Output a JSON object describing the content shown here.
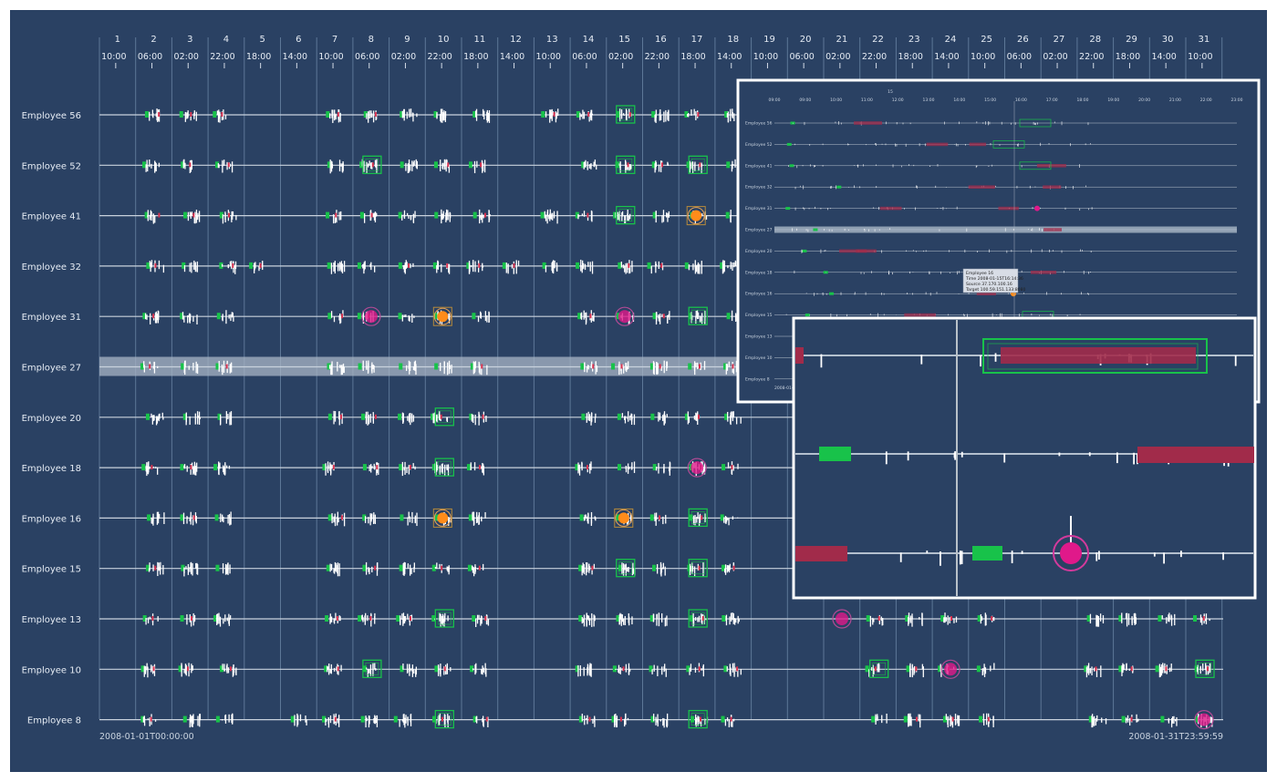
{
  "timeline": {
    "days": [
      "1",
      "2",
      "3",
      "4",
      "5",
      "6",
      "7",
      "8",
      "9",
      "10",
      "11",
      "12",
      "13",
      "14",
      "15",
      "16",
      "17",
      "18",
      "19",
      "20",
      "21",
      "22",
      "23",
      "24",
      "25",
      "26",
      "27",
      "28",
      "29",
      "30",
      "31"
    ],
    "times": [
      "10:00",
      "06:00",
      "02:00",
      "22:00",
      "18:00",
      "14:00",
      "10:00",
      "06:00",
      "02:00",
      "22:00",
      "18:00",
      "14:00",
      "10:00",
      "06:00",
      "02:00",
      "22:00",
      "18:00",
      "14:00",
      "10:00",
      "06:00",
      "02:00",
      "22:00",
      "18:00",
      "14:00",
      "10:00",
      "06:00",
      "02:00",
      "22:00",
      "18:00",
      "14:00",
      "10:00"
    ],
    "employees": [
      "Employee 56",
      "Employee 52",
      "Employee 41",
      "Employee 32",
      "Employee 31",
      "Employee 27",
      "Employee 20",
      "Employee 18",
      "Employee 16",
      "Employee 15",
      "Employee 13",
      "Employee 10",
      "Employee 8"
    ],
    "highlighted_employee": "Employee 27",
    "start_label": "2008-01-01T00:00:00",
    "end_label": "2008-01-31T23:59:59"
  },
  "detail_view": {
    "day_label": "15",
    "hours": [
      "09:00",
      "09:00",
      "10:00",
      "11:00",
      "12:00",
      "13:00",
      "14:00",
      "15:00",
      "16:00",
      "17:00",
      "18:00",
      "19:00",
      "20:00",
      "21:00",
      "22:00",
      "23:00"
    ],
    "employees": [
      "Employee 56",
      "Employee 52",
      "Employee 41",
      "Employee 32",
      "Employee 31",
      "Employee 27",
      "Employee 20",
      "Employee 18",
      "Employee 16",
      "Employee 15",
      "Employee 13",
      "Employee 10",
      "Employee 8"
    ],
    "start_label": "2008-01-",
    "tooltip": {
      "line1": "Employee 16",
      "line2": "Time 2008-01-15T16:14:36",
      "line3": "Source 37.170.100.16",
      "line4": "Target 100.59.151.133:8080"
    }
  },
  "colors": {
    "background": "#2a4163",
    "highlight_row": "#a9b6c6",
    "login": "#18c24a",
    "alert_red": "#7a2a4a",
    "alert_orange": "#ff8c1a",
    "alert_magenta": "#e0198a"
  }
}
